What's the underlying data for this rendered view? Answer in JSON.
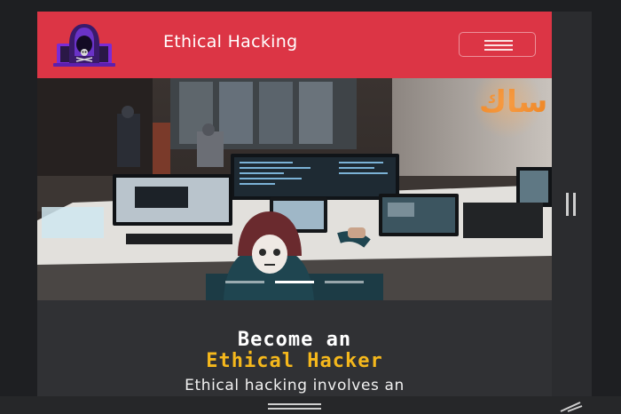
{
  "navbar": {
    "brand": "Ethical Hacking",
    "logo_icon": "hooded-hacker-laptop-icon",
    "toggler_icon": "hamburger-menu-icon",
    "background": "#dc3545"
  },
  "hero": {
    "image": "hacker-workspace-photo",
    "slide_count": 3,
    "active_slide": 2
  },
  "content": {
    "headline_line1": "Become an",
    "headline_line2": "Ethical Hacker",
    "lead_text": "Ethical hacking involves an",
    "accent_color": "#f5b81c"
  }
}
